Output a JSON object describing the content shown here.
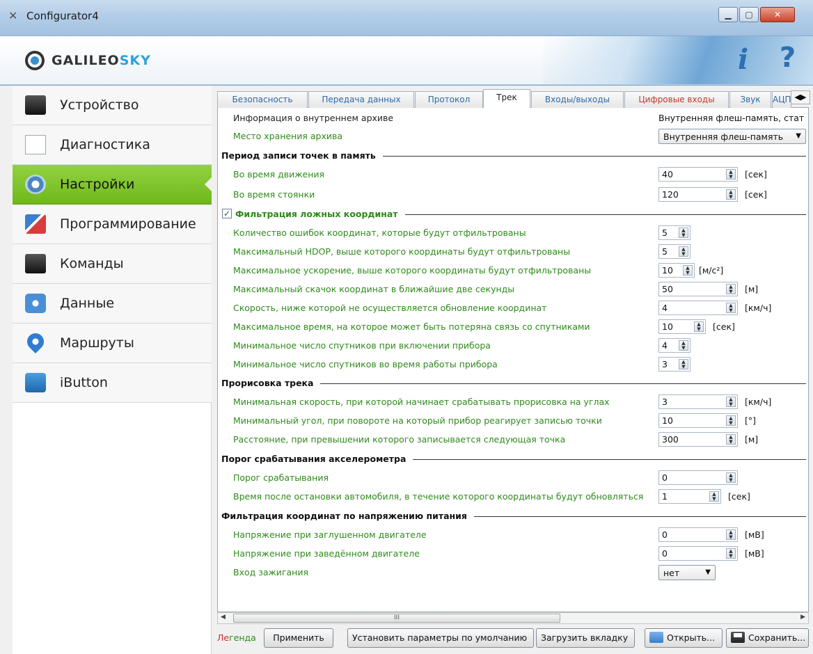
{
  "window": {
    "title": "Configurator4",
    "min": "▁",
    "max": "▢",
    "close": "✕"
  },
  "header": {
    "logo_main": "GALILEO",
    "logo_accent": "SKY",
    "info": "i",
    "help": "?"
  },
  "sidebar": {
    "items": [
      {
        "label": "Устройство",
        "icon": "device-icon"
      },
      {
        "label": "Диагностика",
        "icon": "diagnostics-chart-icon"
      },
      {
        "label": "Настройки",
        "icon": "gear-icon",
        "active": true
      },
      {
        "label": "Программирование",
        "icon": "programming-icon"
      },
      {
        "label": "Команды",
        "icon": "terminal-icon"
      },
      {
        "label": "Данные",
        "icon": "data-icon"
      },
      {
        "label": "Маршруты",
        "icon": "map-pin-icon"
      },
      {
        "label": "iButton",
        "icon": "ibutton-lock-icon"
      }
    ]
  },
  "tabs": [
    "Безопасность",
    "Передача данных",
    "Протокол",
    "Трек",
    "Входы/выходы",
    "Цифровые входы",
    "Звук",
    "АЦП"
  ],
  "active_tab": "Трек",
  "archive": {
    "info_label": "Информация о внутреннем архиве",
    "info_value": "Внутренняя флеш-память, стат",
    "storage_label": "Место хранения архива",
    "storage_value": "Внутренняя флеш-память"
  },
  "period": {
    "title": "Период записи точек в память",
    "moving_label": "Во время движения",
    "moving_value": "40",
    "moving_unit": "[сек]",
    "parking_label": "Во время стоянки",
    "parking_value": "120",
    "parking_unit": "[сек]"
  },
  "filter": {
    "title": "Фильтрация ложных координат",
    "checked": true,
    "check": "✓",
    "rows": [
      {
        "label": "Количество ошибок координат, которые будут отфильтрованы",
        "value": "5",
        "unit": ""
      },
      {
        "label": "Максимальный HDOP, выше которого координаты будут отфильтрованы",
        "value": "5",
        "unit": ""
      },
      {
        "label": "Максимальное ускорение, выше которого координаты будут отфильтрованы",
        "value": "10",
        "unit": "[м/с²]"
      },
      {
        "label": "Максимальный скачок координат в ближайшие две секунды",
        "value": "50",
        "unit": "[м]"
      },
      {
        "label": "Скорость, ниже которой не осуществляется обновление координат",
        "value": "4",
        "unit": "[км/ч]"
      },
      {
        "label": "Максимальное время, на которое может быть потеряна связь со спутниками",
        "value": "10",
        "unit": "[сек]"
      },
      {
        "label": "Минимальное число спутников при включении прибора",
        "value": "4",
        "unit": ""
      },
      {
        "label": "Минимальное число спутников во время работы прибора",
        "value": "3",
        "unit": ""
      }
    ]
  },
  "track": {
    "title": "Прорисовка трека",
    "rows": [
      {
        "label": "Минимальная скорость, при которой начинает срабатывать прорисовка на углах",
        "value": "3",
        "unit": "[км/ч]"
      },
      {
        "label": "Минимальный угол, при повороте на который прибор реагирует записью точки",
        "value": "10",
        "unit": "[°]"
      },
      {
        "label": "Расстояние, при превышении которого записывается следующая точка",
        "value": "300",
        "unit": "[м]"
      }
    ]
  },
  "accel": {
    "title": "Порог срабатывания акселерометра",
    "threshold_label": "Порог срабатывания",
    "threshold_value": "0",
    "after_stop_label": "Время после остановки автомобиля, в течение которого координаты будут обновляться",
    "after_stop_value": "1",
    "after_stop_unit": "[сек]"
  },
  "voltage": {
    "title": "Фильтрация координат по напряжению питания",
    "off_label": "Напряжение при заглушенном двигателе",
    "off_value": "0",
    "off_unit": "[мВ]",
    "on_label": "Напряжение при заведённом двигателе",
    "on_value": "0",
    "on_unit": "[мВ]",
    "ignition_label": "Вход зажигания",
    "ignition_value": "нет"
  },
  "scroll": {
    "thumb": "III",
    "left": "◀",
    "right": "▶"
  },
  "footer": {
    "legend_red": "Ле",
    "legend_green": "генда",
    "apply": "Применить",
    "defaults": "Установить параметры по умолчанию",
    "load_tab": "Загрузить вкладку",
    "open": "Открыть...",
    "save": "Сохранить..."
  },
  "colors": {
    "accent_green": "#2f8a1c",
    "active_nav": "#7dc22a",
    "link_blue": "#2c6aa8"
  }
}
